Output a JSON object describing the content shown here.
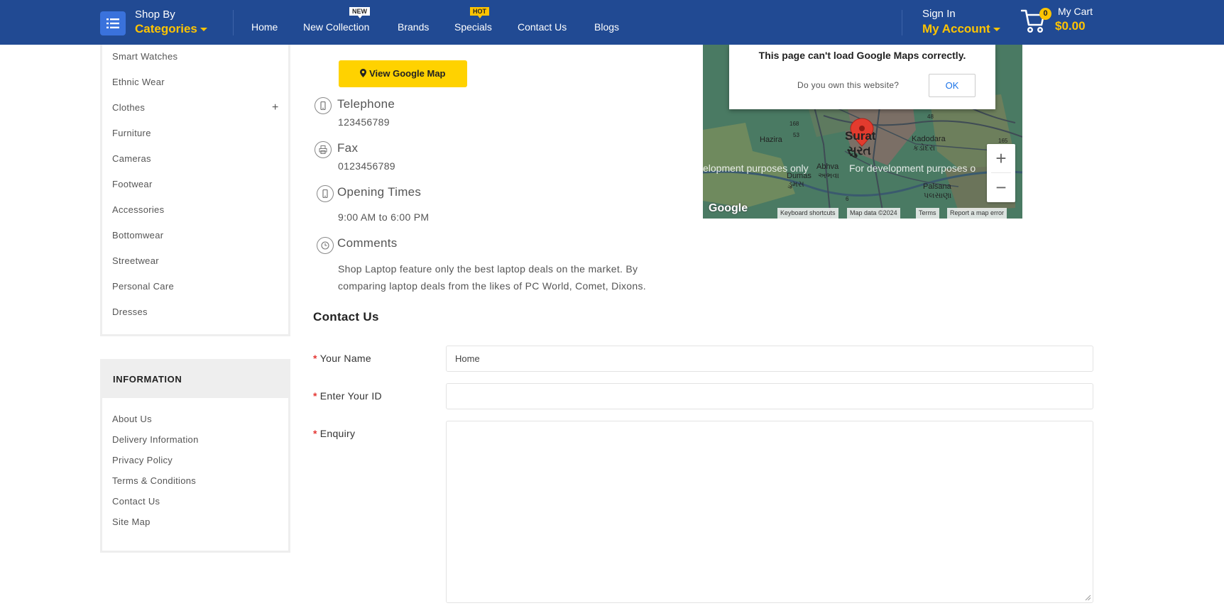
{
  "header": {
    "shop_by": "Shop By",
    "categories": "Categories",
    "nav": [
      {
        "label": "Home"
      },
      {
        "label": "New Collection",
        "badge": "NEW"
      },
      {
        "label": "Brands"
      },
      {
        "label": "Specials",
        "badge": "HOT"
      },
      {
        "label": "Contact Us"
      },
      {
        "label": "Blogs"
      }
    ],
    "sign_in": "Sign In",
    "my_account": "My Account",
    "cart_count": "0",
    "my_cart": "My Cart",
    "cart_total": "$0.00"
  },
  "sidebar": {
    "categories": [
      "Smart Watches",
      "Ethnic Wear",
      "Clothes",
      "Furniture",
      "Cameras",
      "Footwear",
      "Accessories",
      "Bottomwear",
      "Streetwear",
      "Personal Care",
      "Dresses"
    ],
    "expand_symbol": "+",
    "information_title": "INFORMATION",
    "information_links": [
      "About Us",
      "Delivery Information",
      "Privacy Policy",
      "Terms & Conditions",
      "Contact Us",
      "Site Map"
    ]
  },
  "store_info": {
    "map_button": "View Google Map",
    "telephone_label": "Telephone",
    "telephone": "123456789",
    "fax_label": "Fax",
    "fax": "0123456789",
    "opening_label": "Opening Times",
    "opening": "9:00 AM to 6:00 PM",
    "comments_label": "Comments",
    "comments": "Shop Laptop feature only the best laptop deals on the market. By comparing laptop deals from the likes of PC World, Comet, Dixons."
  },
  "map": {
    "error_message": "This page can't load Google Maps correctly.",
    "own_question": "Do you own this website?",
    "ok_label": "OK",
    "dev_text_left": "elopment purposes only",
    "dev_text_right": "For development purposes o",
    "city": "Surat",
    "city_gujarati": "સુરત",
    "places": [
      "Hazira",
      "Kadodara",
      "કડોદરા",
      "Abhva",
      "અભવા",
      "Dumas",
      "ડુમસ",
      "Palsana",
      "પલસાણા"
    ],
    "road_badges": [
      "168",
      "53",
      "48",
      "165",
      "6",
      "53"
    ],
    "google_logo": "Google",
    "attribution": [
      "Keyboard shortcuts",
      "Map data ©2024",
      "Terms",
      "Report a map error"
    ],
    "zoom_in": "+",
    "zoom_out": "−"
  },
  "form": {
    "title": "Contact Us",
    "required_mark": "*",
    "name_label": "Your Name",
    "name_value": "Home",
    "id_label": "Enter Your ID",
    "id_value": "",
    "enquiry_label": "Enquiry"
  },
  "colors": {
    "header_bg": "#214a93",
    "accent_yellow": "#ffc400",
    "button_yellow": "#ffd200",
    "required_red": "#e53935"
  }
}
